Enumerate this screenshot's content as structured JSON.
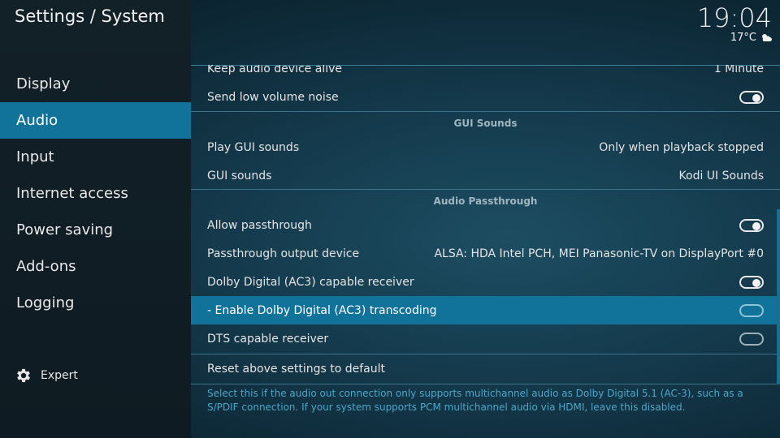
{
  "header": {
    "title": "Settings / System",
    "time": "19:04",
    "temperature": "17°C",
    "weather_icon": "partly-cloudy-icon"
  },
  "sidebar": {
    "items": [
      {
        "label": "Display"
      },
      {
        "label": "Audio"
      },
      {
        "label": "Input"
      },
      {
        "label": "Internet access"
      },
      {
        "label": "Power saving"
      },
      {
        "label": "Add-ons"
      },
      {
        "label": "Logging"
      }
    ],
    "active_index": 1,
    "expert_label": "Expert",
    "expert_icon": "gear-icon"
  },
  "settings": {
    "keep_alive": {
      "label": "Keep audio device alive",
      "value": "1 Minute"
    },
    "low_volume_noise": {
      "label": "Send low volume noise",
      "state": "on"
    },
    "gui_sounds_group": "GUI Sounds",
    "play_gui_sounds": {
      "label": "Play GUI sounds",
      "value": "Only when playback stopped"
    },
    "gui_sounds": {
      "label": "GUI sounds",
      "value": "Kodi UI Sounds"
    },
    "passthrough_group": "Audio Passthrough",
    "allow_passthrough": {
      "label": "Allow passthrough",
      "state": "on"
    },
    "passthrough_device": {
      "label": "Passthrough output device",
      "value": "ALSA: HDA Intel PCH, MEI Panasonic-TV on DisplayPort #0"
    },
    "ac3_receiver": {
      "label": "Dolby Digital (AC3) capable receiver",
      "state": "on"
    },
    "ac3_transcoding": {
      "label": "- Enable Dolby Digital (AC3) transcoding",
      "state": "off"
    },
    "dts_receiver": {
      "label": "DTS capable receiver",
      "state": "off"
    },
    "reset": {
      "label": "Reset above settings to default"
    }
  },
  "description": "Select this if the audio out connection only supports multichannel audio as Dolby Digital 5.1 (AC-3), such as a S/PDIF connection. If your system supports PCM multichannel audio via HDMI, leave this disabled.",
  "colors": {
    "accent": "#12739a",
    "description_text": "#4fa6c9"
  }
}
